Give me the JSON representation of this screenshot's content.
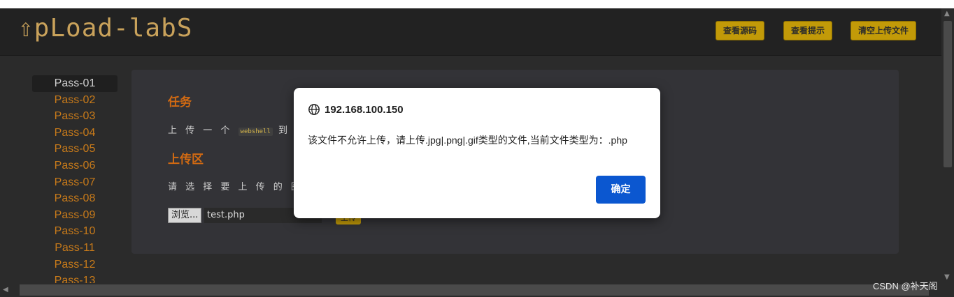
{
  "header": {
    "logo": "⇧pLoad-labS",
    "buttons": [
      "查看源码",
      "查看提示",
      "清空上传文件"
    ]
  },
  "sidebar": {
    "items": [
      "Pass-01",
      "Pass-02",
      "Pass-03",
      "Pass-04",
      "Pass-05",
      "Pass-06",
      "Pass-07",
      "Pass-08",
      "Pass-09",
      "Pass-10",
      "Pass-11",
      "Pass-12",
      "Pass-13"
    ]
  },
  "panel": {
    "task_title": "任务",
    "task_text_prefix": "上 传 一 个",
    "task_code": "webshell",
    "task_text_suffix": "到 服",
    "upload_title": "上传区",
    "upload_prompt": "请 选 择 要 上 传 的 图 片 :",
    "browse_label": "浏览...",
    "file_name": "test.php",
    "upload_button": "上传"
  },
  "dialog": {
    "origin": "192.168.100.150",
    "message": "该文件不允许上传，请上传.jpg|.png|.gif类型的文件,当前文件类型为：.php",
    "ok_label": "确定"
  },
  "watermark": "CSDN @补天阁",
  "colors": {
    "accent": "#c29a08",
    "title": "#d26a12",
    "link": "#c77a1a",
    "dialog_button": "#0b57d0"
  }
}
